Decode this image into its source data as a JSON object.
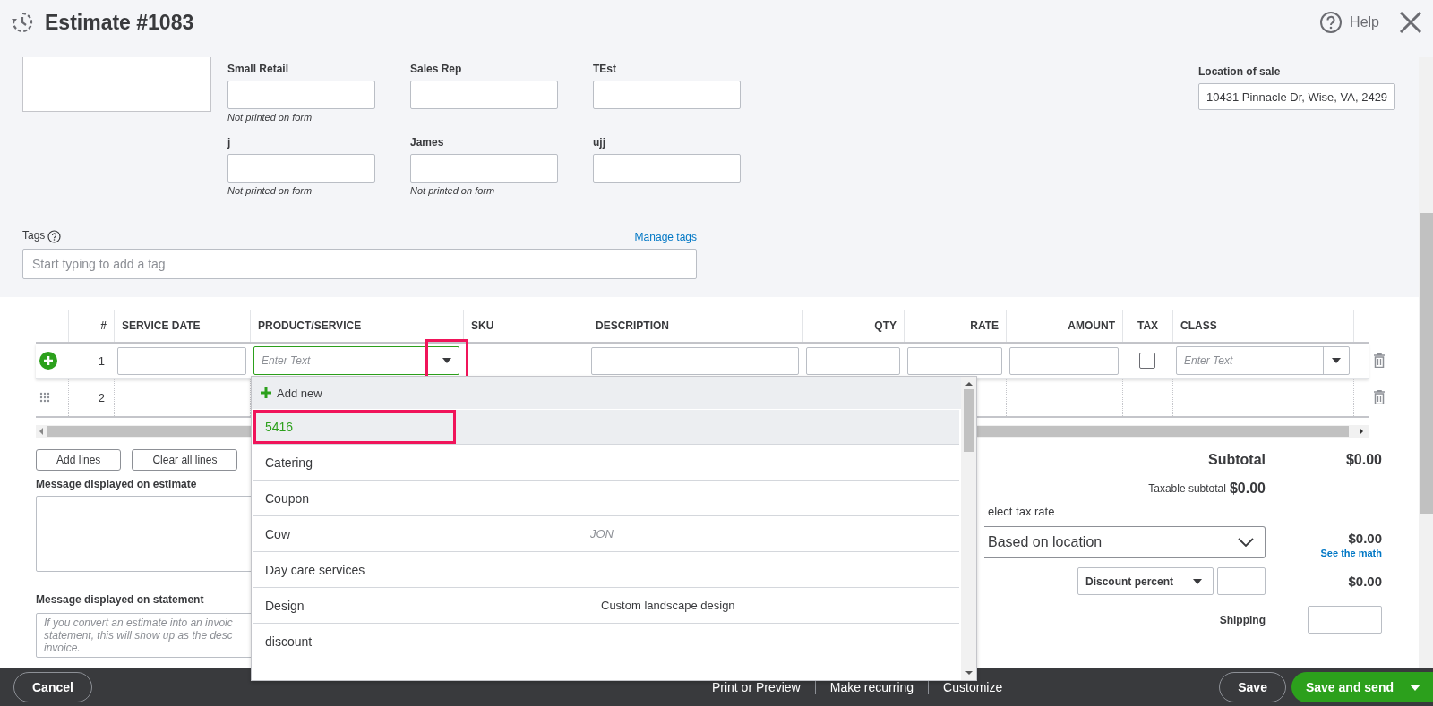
{
  "header": {
    "title": "Estimate #1083",
    "help": "Help"
  },
  "custom_fields": [
    {
      "label": "Small Retail",
      "note": "Not printed on form"
    },
    {
      "label": "Sales Rep"
    },
    {
      "label": "TEst"
    },
    {
      "label": "j",
      "note": "Not printed on form"
    },
    {
      "label": "James",
      "note": "Not printed on form"
    },
    {
      "label": "ujj"
    }
  ],
  "location": {
    "label": "Location of sale",
    "value": "10431 Pinnacle Dr, Wise, VA, 2429"
  },
  "tags": {
    "label": "Tags",
    "manage": "Manage tags",
    "placeholder": "Start typing to add a tag"
  },
  "table": {
    "columns": [
      "#",
      "SERVICE DATE",
      "PRODUCT/SERVICE",
      "SKU",
      "DESCRIPTION",
      "QTY",
      "RATE",
      "AMOUNT",
      "TAX",
      "CLASS"
    ],
    "rows": [
      {
        "number": "1",
        "editing": true,
        "product_placeholder": "Enter Text",
        "class_placeholder": "Enter Text",
        "taxable": false,
        "toggle_highlighted": true
      },
      {
        "number": "2",
        "editing": false
      }
    ]
  },
  "table_buttons": [
    "Add lines",
    "Clear all lines"
  ],
  "messages": [
    {
      "label": "Message displayed on estimate"
    },
    {
      "label": "Message displayed on statement",
      "placeholder_lines": [
        "If you convert an estimate into an invoic",
        "statement, this will show up as the desc",
        "invoice."
      ]
    }
  ],
  "totals": {
    "subtotal_label": "Subtotal",
    "subtotal": "$0.00",
    "taxable_label": "Taxable subtotal",
    "taxable": "$0.00",
    "tax_rate_label": "elect tax rate",
    "tax_rate": "Based on location",
    "tax": "$0.00",
    "see_math": "See the math",
    "discount_type": "Discount percent",
    "discount": "$0.00",
    "shipping_label": "Shipping"
  },
  "dropdown": {
    "add_new": "Add new",
    "items": [
      {
        "name": "5416",
        "selected": true,
        "highlighted": true
      },
      {
        "name": "Catering",
        "selected": false,
        "highlighted": false
      },
      {
        "name": "Coupon",
        "selected": false,
        "highlighted": false
      },
      {
        "name": "Cow",
        "detail": "JON",
        "selected": false,
        "highlighted": false
      },
      {
        "name": "Day care services",
        "selected": false,
        "highlighted": false
      },
      {
        "name": "Design",
        "description": "Custom landscape design",
        "selected": false,
        "highlighted": false
      },
      {
        "name": "discount",
        "selected": false,
        "highlighted": false
      }
    ]
  },
  "footer": {
    "cancel": "Cancel",
    "links": [
      "Print or Preview",
      "Make recurring",
      "Customize"
    ],
    "save": "Save",
    "save_send": "Save and send"
  }
}
